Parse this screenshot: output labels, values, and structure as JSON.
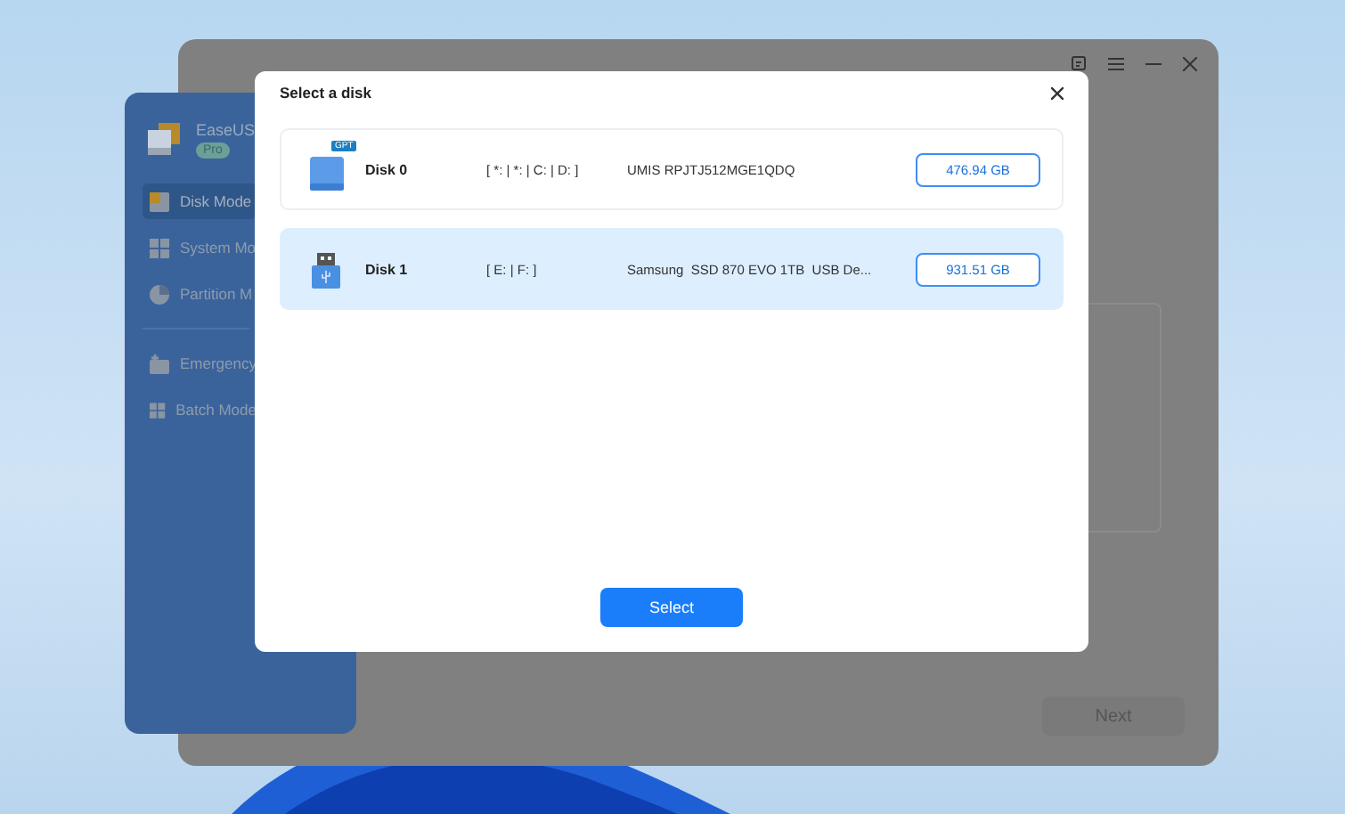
{
  "app": {
    "brand": "EaseUS",
    "badge": "Pro",
    "nav": [
      {
        "label": "Disk Mode",
        "kind": "disk",
        "selected": true
      },
      {
        "label": "System Mo",
        "kind": "system",
        "selected": false
      },
      {
        "label": "Partition M",
        "kind": "partition",
        "selected": false
      },
      {
        "label": "Emergency",
        "kind": "emergency",
        "selected": false
      },
      {
        "label": "Batch Mode",
        "kind": "batch",
        "selected": false
      }
    ],
    "next_button": {
      "label": "Next",
      "disabled": true
    }
  },
  "dialog": {
    "title": "Select a disk",
    "disks": [
      {
        "kind": "gpt",
        "badge": "GPT",
        "name": "Disk 0",
        "partitions": "[ *: | *: | C: | D: ]",
        "model": "UMIS RPJTJ512MGE1QDQ",
        "size": "476.94 GB",
        "selected": false
      },
      {
        "kind": "usb",
        "name": "Disk 1",
        "partitions": "[ E: | F: ]",
        "model": "Samsung  SSD 870 EVO 1TB  USB De...",
        "size": "931.51 GB",
        "selected": true
      }
    ],
    "select_button": "Select"
  }
}
